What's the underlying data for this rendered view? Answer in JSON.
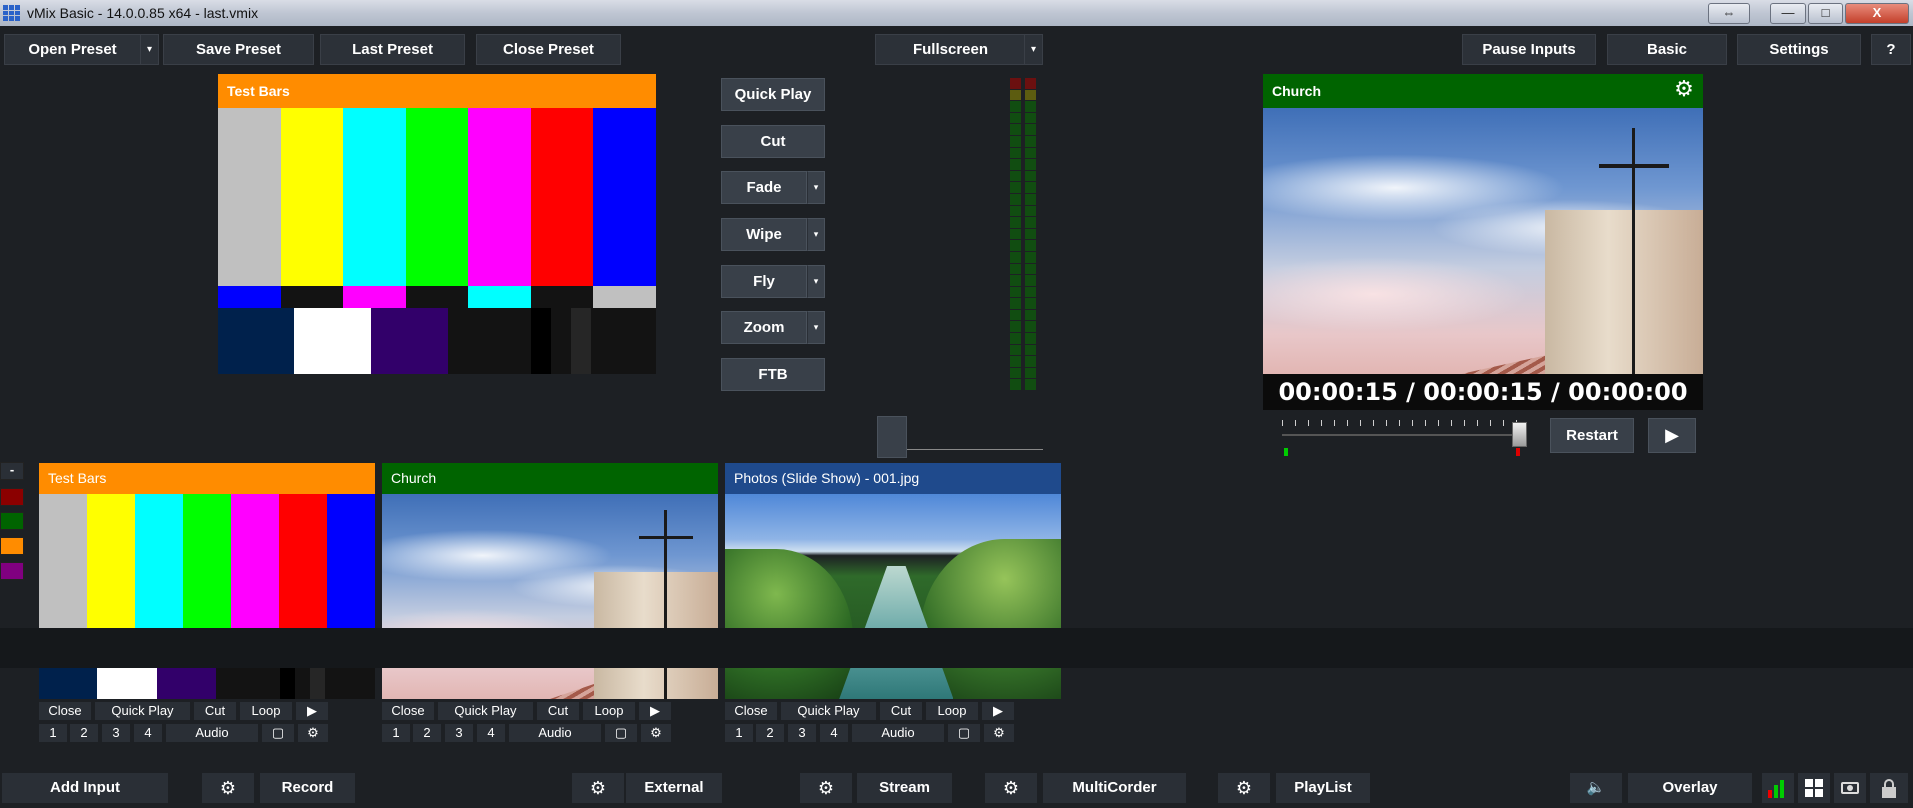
{
  "window": {
    "title": "vMix Basic - 14.0.0.85 x64 - last.vmix",
    "resize_glyph": "⇔",
    "minimize_glyph": "—",
    "maximize_glyph": "□",
    "close_glyph": "X"
  },
  "toolbar": {
    "open_preset": "Open Preset",
    "save_preset": "Save Preset",
    "last_preset": "Last Preset",
    "close_preset": "Close Preset",
    "fullscreen": "Fullscreen",
    "pause_inputs": "Pause Inputs",
    "basic": "Basic",
    "settings": "Settings",
    "help": "?",
    "dropdown_glyph": "▾"
  },
  "preview": {
    "title": "Test Bars"
  },
  "output": {
    "title": "Church",
    "time_display": "00:00:15  /  00:00:15  /  00:00:00",
    "restart": "Restart",
    "play_glyph": "▶"
  },
  "transitions": {
    "quick_play": "Quick Play",
    "cut": "Cut",
    "fade": "Fade",
    "wipe": "Wipe",
    "fly": "Fly",
    "zoom": "Zoom",
    "ftb": "FTB"
  },
  "color_tags": {
    "collapse_label": "-",
    "colors": [
      "#8b0000",
      "#006400",
      "#ff8c00",
      "#800080"
    ]
  },
  "inputs": [
    {
      "title": "Test Bars",
      "close": "Close",
      "quick_play": "Quick Play",
      "cut": "Cut",
      "loop": "Loop",
      "n1": "1",
      "n2": "2",
      "n3": "3",
      "n4": "4",
      "audio": "Audio"
    },
    {
      "title": "Church",
      "close": "Close",
      "quick_play": "Quick Play",
      "cut": "Cut",
      "loop": "Loop",
      "n1": "1",
      "n2": "2",
      "n3": "3",
      "n4": "4",
      "audio": "Audio"
    },
    {
      "title": "Photos (Slide Show) - 001.jpg",
      "close": "Close",
      "quick_play": "Quick Play",
      "cut": "Cut",
      "loop": "Loop",
      "n1": "1",
      "n2": "2",
      "n3": "3",
      "n4": "4",
      "audio": "Audio"
    }
  ],
  "bottom_bar": {
    "add_input": "Add Input",
    "record": "Record",
    "external": "External",
    "stream": "Stream",
    "multicorder": "MultiCorder",
    "playlist": "PlayList",
    "overlay": "Overlay",
    "gear_glyph": "⚙",
    "speaker_glyph": "🔈"
  }
}
